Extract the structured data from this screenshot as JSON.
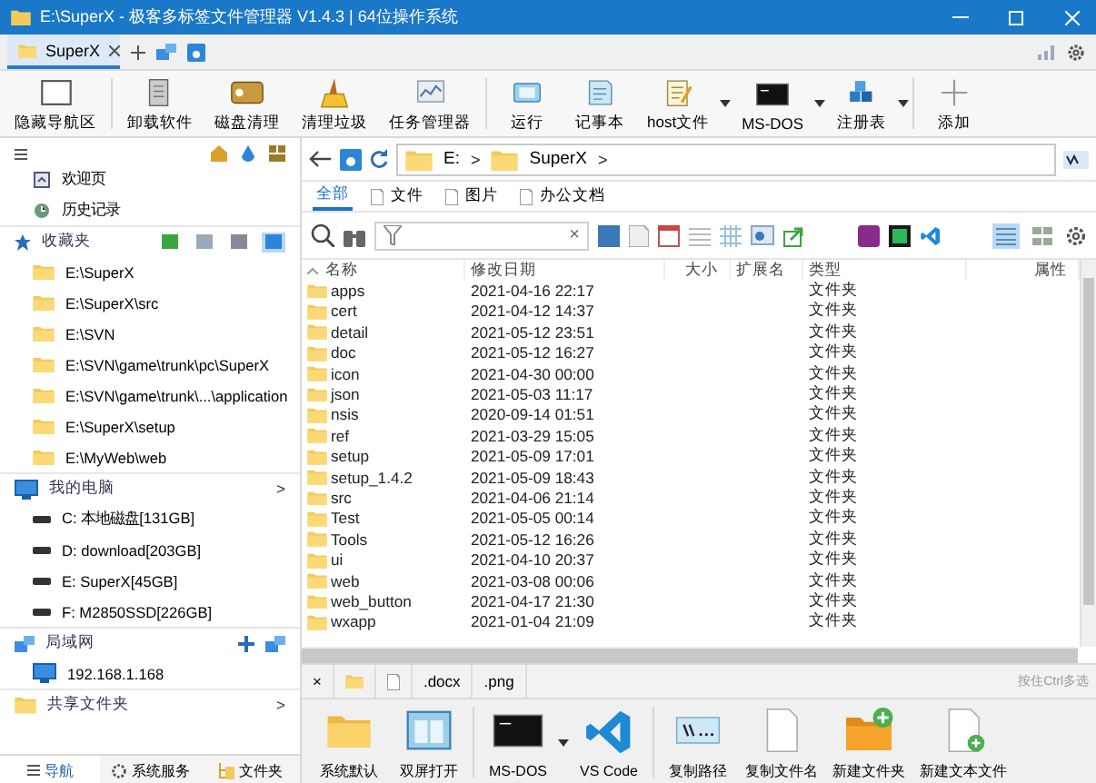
{
  "window": {
    "title": "E:\\SuperX - 极客多标签文件管理器 V1.4.3 | 64位操作系统"
  },
  "tabs": [
    {
      "label": "SuperX",
      "selected": true
    }
  ],
  "toolbar": [
    {
      "label": "隐藏导航区",
      "dropdown": false
    },
    {
      "label": "卸载软件",
      "dropdown": false
    },
    {
      "label": "磁盘清理",
      "dropdown": false
    },
    {
      "label": "清理垃圾",
      "dropdown": false
    },
    {
      "label": "任务管理器",
      "dropdown": false
    },
    {
      "label": "运行",
      "dropdown": false
    },
    {
      "label": "记事本",
      "dropdown": false
    },
    {
      "label": "host文件",
      "dropdown": true
    },
    {
      "label": "MS-DOS",
      "dropdown": true
    },
    {
      "label": "注册表",
      "dropdown": true
    },
    {
      "label": "添加",
      "dropdown": false
    }
  ],
  "sidebar": {
    "nav_items": [
      "欢迎页",
      "历史记录"
    ],
    "favorites": {
      "title": "收藏夹",
      "view_buttons": [
        {
          "selected": false
        },
        {
          "selected": false
        },
        {
          "selected": false
        },
        {
          "selected": true
        }
      ],
      "items": [
        "E:\\SuperX",
        "E:\\SuperX\\src",
        "E:\\SVN",
        "E:\\SVN\\game\\trunk\\pc\\SuperX",
        "E:\\SVN\\game\\trunk\\...\\application",
        "E:\\SuperX\\setup",
        "E:\\MyWeb\\web"
      ]
    },
    "computer": {
      "title": "我的电脑",
      "chevron": ">",
      "drives": [
        "C: 本地磁盘[131GB]",
        "D: download[203GB]",
        "E: SuperX[45GB]",
        "F: M2850SSD[226GB]"
      ]
    },
    "network": {
      "title": "局域网",
      "items": [
        "192.168.1.168"
      ]
    },
    "shared": {
      "title": "共享文件夹",
      "chevron": ">"
    },
    "bottom_tabs": [
      {
        "label": "导航",
        "selected": true
      },
      {
        "label": "系统服务",
        "selected": false
      },
      {
        "label": "文件夹",
        "selected": false
      }
    ]
  },
  "address": {
    "crumbs": [
      "E:",
      "SuperX"
    ],
    "separator": ">"
  },
  "filter_tabs": [
    {
      "label": "全部",
      "selected": true
    },
    {
      "label": "文件",
      "selected": false
    },
    {
      "label": "图片",
      "selected": false
    },
    {
      "label": "办公文档",
      "selected": false
    }
  ],
  "search": {
    "clear": "×"
  },
  "view_modes": [
    {
      "selected": true
    },
    {
      "selected": false
    }
  ],
  "table": {
    "columns": [
      "名称",
      "修改日期",
      "大小",
      "扩展名",
      "类型",
      "属性"
    ],
    "rows": [
      {
        "name": "apps",
        "modified": "2021-04-16 22:17",
        "type": "文件夹"
      },
      {
        "name": "cert",
        "modified": "2021-04-12 14:37",
        "type": "文件夹"
      },
      {
        "name": "detail",
        "modified": "2021-05-12 23:51",
        "type": "文件夹"
      },
      {
        "name": "doc",
        "modified": "2021-05-12 16:27",
        "type": "文件夹"
      },
      {
        "name": "icon",
        "modified": "2021-04-30 00:00",
        "type": "文件夹"
      },
      {
        "name": "json",
        "modified": "2021-05-03 11:17",
        "type": "文件夹"
      },
      {
        "name": "nsis",
        "modified": "2020-09-14 01:51",
        "type": "文件夹"
      },
      {
        "name": "ref",
        "modified": "2021-03-29 15:05",
        "type": "文件夹"
      },
      {
        "name": "setup",
        "modified": "2021-05-09 17:01",
        "type": "文件夹"
      },
      {
        "name": "setup_1.4.2",
        "modified": "2021-05-09 18:43",
        "type": "文件夹"
      },
      {
        "name": "src",
        "modified": "2021-04-06 21:14",
        "type": "文件夹"
      },
      {
        "name": "Test",
        "modified": "2021-05-05 00:14",
        "type": "文件夹"
      },
      {
        "name": "Tools",
        "modified": "2021-05-12 16:26",
        "type": "文件夹"
      },
      {
        "name": "ui",
        "modified": "2021-04-10 20:37",
        "type": "文件夹"
      },
      {
        "name": "web",
        "modified": "2021-03-08 00:06",
        "type": "文件夹"
      },
      {
        "name": "web_button",
        "modified": "2021-04-17 21:30",
        "type": "文件夹"
      },
      {
        "name": "wxapp",
        "modified": "2021-01-04 21:09",
        "type": "文件夹"
      }
    ]
  },
  "ext_tabs": {
    "close": "×",
    "extensions": [
      ".docx",
      ".png"
    ],
    "hint": "按住Ctrl多选"
  },
  "actions": [
    {
      "label": "系统默认",
      "dropdown": false
    },
    {
      "label": "双屏打开",
      "dropdown": false
    },
    {
      "label": "MS-DOS",
      "dropdown": true
    },
    {
      "label": "VS Code",
      "dropdown": false
    },
    {
      "label": "复制路径",
      "dropdown": false
    },
    {
      "label": "复制文件名",
      "dropdown": false
    },
    {
      "label": "新建文件夹",
      "dropdown": false
    },
    {
      "label": "新建文本文件",
      "dropdown": false
    }
  ]
}
